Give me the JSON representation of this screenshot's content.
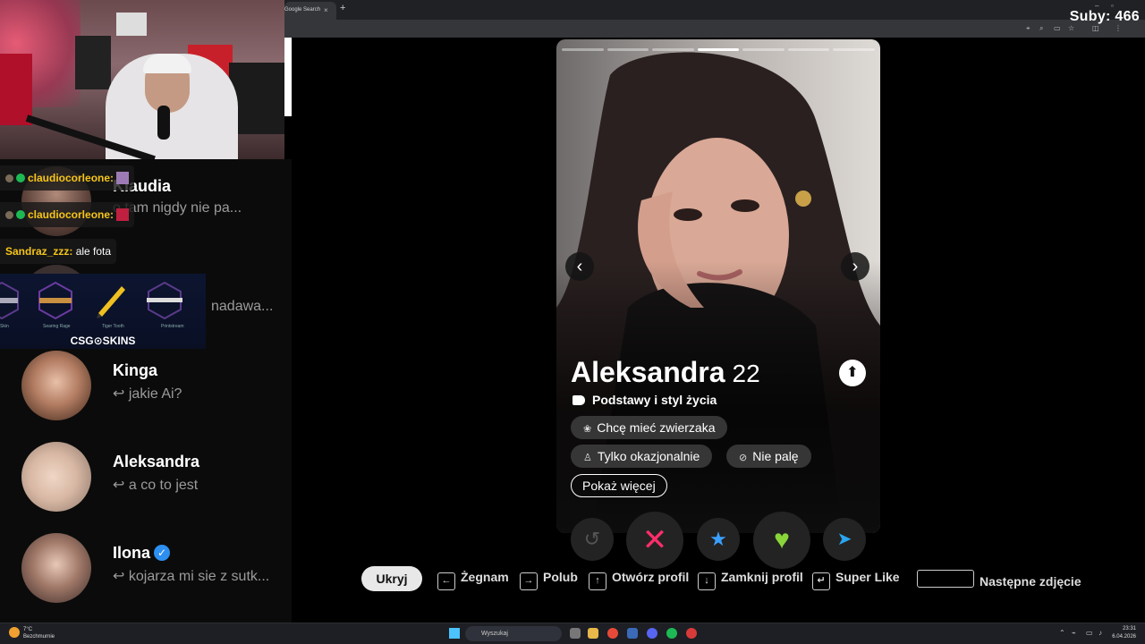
{
  "browser": {
    "tab_title": "Google Search",
    "tab_close": "×",
    "new_tab": "+"
  },
  "overlay": {
    "subs_label": "Suby: 466"
  },
  "chat": [
    {
      "user": "claudiocorleone:",
      "text": ""
    },
    {
      "user": "claudiocorleone:",
      "text": ""
    },
    {
      "user": "Sandraz_zzz:",
      "text": "ale fota"
    }
  ],
  "sponsor": {
    "logo": "CSG⊙SKINS",
    "items": [
      "Skin",
      "Searing Rage",
      "Tiger Tooth",
      "Printstream"
    ]
  },
  "conversations": [
    {
      "name": "Klaudia",
      "message": "o tam nigdy nie pa...",
      "verified": false
    },
    {
      "name": "",
      "message": "nadawa...",
      "verified": true
    },
    {
      "name": "Kinga",
      "message": "jakie Ai?",
      "verified": false
    },
    {
      "name": "Aleksandra",
      "message": "a co to jest",
      "verified": false
    },
    {
      "name": "Ilona",
      "message": "kojarza mi sie z sutk...",
      "verified": true
    }
  ],
  "profile": {
    "name": "Aleksandra",
    "age": "22",
    "section_title": "Podstawy i styl życia",
    "chips": [
      {
        "icon": "paw-icon",
        "label": "Chcę mieć zwierzaka"
      },
      {
        "icon": "glass-icon",
        "label": "Tylko okazjonalnie"
      },
      {
        "icon": "no-smoking-icon",
        "label": "Nie palę"
      }
    ],
    "more_label": "Pokaż więcej",
    "photo_count": 7,
    "active_photo_index": 3
  },
  "hints": {
    "hide": "Ukryj",
    "nope": "Żegnam",
    "like": "Polub",
    "open_profile": "Otwórz profil",
    "close_profile": "Zamknij profil",
    "super_like": "Super Like",
    "next_photo": "Następne zdjęcie"
  },
  "taskbar": {
    "search_placeholder": "Wyszukaj",
    "weather_temp": "7°C",
    "weather_desc": "Bezchmurnie",
    "time": "23:31",
    "date": "6.04.2026"
  },
  "colors": {
    "nope": "#ff2e6a",
    "like": "#8ad63a",
    "super_like": "#3aa0ff",
    "boost": "#2aa5ef",
    "chat_user": "#f5c518",
    "verified": "#2d8ff0"
  }
}
